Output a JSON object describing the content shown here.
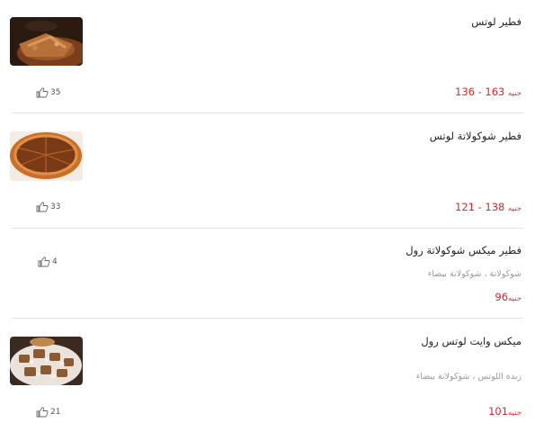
{
  "items": [
    {
      "name": "فطير لوتس",
      "price": "136 - 163",
      "currency": "جنيه",
      "likes": "35"
    },
    {
      "name": "فطير شوكولاتة لوتس",
      "price": "121 - 138",
      "currency": "جنيه",
      "likes": "33"
    },
    {
      "name": "فطير ميكس شوكولاتة رول",
      "description": "شوكولاتة ، شوكولاتة بيضاء",
      "price": "96",
      "currency": "جنيه",
      "likes": "4"
    },
    {
      "name": "ميكس وايت لوتس رول",
      "description": "زبدة اللوتس ، شوكولاتة بيضاء",
      "price": "101",
      "currency": "جنيه",
      "likes": "21"
    }
  ],
  "colors": {
    "price": "#d8292f",
    "description": "#9a9a9a",
    "divider": "#e2e2e2"
  },
  "icons": {
    "like": "thumbs-up-icon"
  }
}
